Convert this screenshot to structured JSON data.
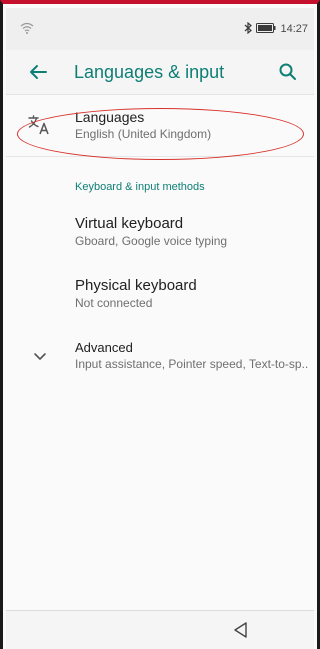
{
  "status_bar": {
    "time": "14:27",
    "icons": [
      "wifi-icon",
      "bluetooth-icon",
      "battery-icon"
    ]
  },
  "app_bar": {
    "title": "Languages & input",
    "back_icon": "arrow-back-icon",
    "search_icon": "search-icon"
  },
  "languages": {
    "title": "Languages",
    "subtitle": "English (United Kingdom)",
    "icon": "translate-icon"
  },
  "keyboard_section": {
    "header": "Keyboard & input methods",
    "items": [
      {
        "title": "Virtual keyboard",
        "subtitle": "Gboard, Google voice typing"
      },
      {
        "title": "Physical keyboard",
        "subtitle": "Not connected"
      }
    ]
  },
  "advanced": {
    "title": "Advanced",
    "subtitle": "Input assistance, Pointer speed, Text-to-sp..",
    "icon": "chevron-down-icon"
  },
  "colors": {
    "accent": "#0e7f75",
    "annotation": "#d6332b",
    "frame_top": "#c4102d"
  }
}
